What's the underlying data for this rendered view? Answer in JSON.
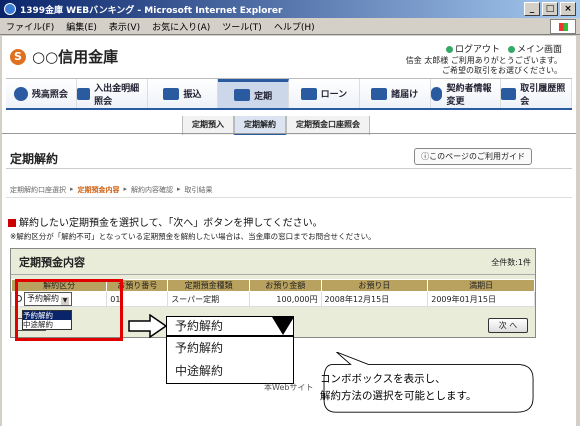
{
  "window": {
    "title": "1399金庫 WEBバンキング - Microsoft Internet Explorer"
  },
  "menu": [
    "ファイル(F)",
    "編集(E)",
    "表示(V)",
    "お気に入り(A)",
    "ツール(T)",
    "ヘルプ(H)"
  ],
  "header": {
    "bank_name": "○○信用金庫",
    "logout": "ログアウト",
    "main_menu": "メイン画面",
    "greeting_line1": "信金 太郎様 ご利用ありがとうございます。",
    "greeting_line2": "ご希望の取引をお選びください。"
  },
  "nav": [
    {
      "label": "残高照会"
    },
    {
      "label": "入出金明細照会"
    },
    {
      "label": "振込"
    },
    {
      "label": "定期"
    },
    {
      "label": "ローン"
    },
    {
      "label": "諸届け"
    },
    {
      "label": "契約者情報変更"
    },
    {
      "label": "取引履歴照会"
    }
  ],
  "subnav": [
    "定期預入",
    "定期解約",
    "定期預金口座照会"
  ],
  "page": {
    "title": "定期解約",
    "guide_button": "このページのご利用ガイド",
    "steps": [
      "定期解約口座選択",
      "定期預金内容",
      "解約内容確認",
      "取引結果"
    ],
    "instruction": "解約したい定期預金を選択して、「次へ」ボタンを押してください。",
    "note": "※解約区分が「解約不可」となっている定期預金を解約したい場合は、当金庫の窓口までお問合せください。"
  },
  "panel": {
    "title": "定期預金内容",
    "count": "全件数:1件",
    "headers": [
      "解約区分",
      "お預り番号",
      "定期預金種類",
      "お預り金額",
      "お預り日",
      "満期日"
    ],
    "row": {
      "select_value": "予約解約",
      "number": "01",
      "type": "スーパー定期",
      "amount": "100,000円",
      "deposit_date": "2008年12月15日",
      "maturity_date": "2009年01月15日"
    },
    "small_options": [
      "予約解約",
      "中途解約"
    ],
    "next_button": "次 へ"
  },
  "callout": {
    "select_value": "予約解約",
    "options": [
      "予約解約",
      "中途解約"
    ],
    "text_line1": "コンボボックスを表示し、",
    "text_line2": "解約方法の選択を可能とします。"
  },
  "footer_partial": "本Webサイト",
  "colors": {
    "accent": "#2a5aa0",
    "highlight": "#e00000",
    "table_header": "#b9a25f"
  }
}
